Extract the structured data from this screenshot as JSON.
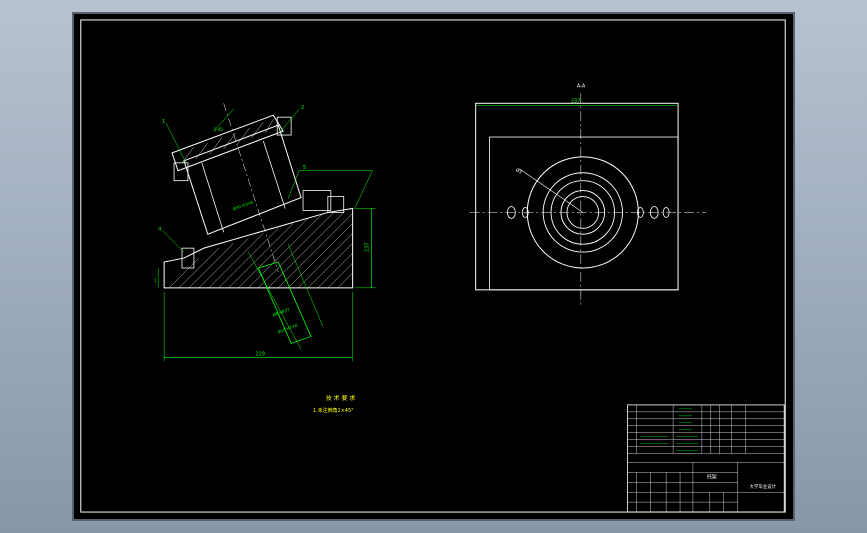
{
  "drawing": {
    "background_color": "#000000",
    "line_colors": {
      "outline": "#ffffff",
      "dimension": "#00ff00",
      "accent": "#ffff00"
    },
    "side_view": {
      "balloon_labels": [
        "1",
        "2",
        "4",
        "5"
      ],
      "dimension_labels": {
        "width": "219",
        "height": "237",
        "left_small": "1",
        "top_angle": "2-45"
      }
    },
    "plan_view": {
      "title": "A-A",
      "width_dim": "237",
      "diameter_dim": "Ø3"
    },
    "tech_notes": {
      "title": "技 术 要 求",
      "line1": "1.未注倒角2×45°"
    },
    "title_block": {
      "part_name": "托架",
      "drawing_no": "大学毕业设计"
    }
  }
}
